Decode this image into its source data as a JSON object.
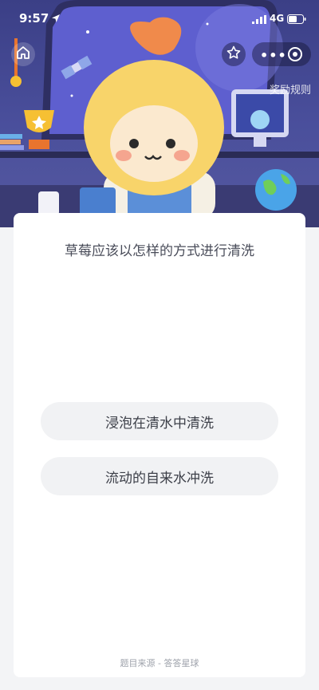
{
  "status_bar": {
    "time": "9:57",
    "network": "4G"
  },
  "toolbar": {
    "reward_rules": "奖励规则"
  },
  "question": {
    "text": "草莓应该以怎样的方式进行清洗"
  },
  "options": [
    {
      "label": "浸泡在清水中清洗"
    },
    {
      "label": "流动的自来水冲洗"
    }
  ],
  "footer": {
    "source": "题目来源 - 答答星球"
  },
  "icons": [
    "location-arrow-icon",
    "signal-icon",
    "battery-icon",
    "home-icon",
    "star-icon",
    "more-icon",
    "close-icon"
  ],
  "colors": {
    "hero_bg": "#4a4f9c",
    "card_bg": "#ffffff",
    "option_bg": "#f1f2f4",
    "question_text": "#4a4d5a"
  }
}
